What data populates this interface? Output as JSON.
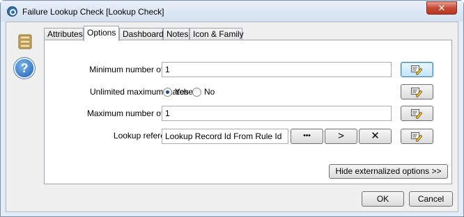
{
  "window": {
    "title": "Failure Lookup Check [Lookup Check]",
    "close_glyph": "✕"
  },
  "sidebar": {
    "icons": [
      "database-icon",
      "help-icon"
    ],
    "help_glyph": "?"
  },
  "tabs": [
    {
      "label": "Attributes",
      "active": false
    },
    {
      "label": "Options",
      "active": true
    },
    {
      "label": "Dashboard",
      "active": false
    },
    {
      "label": "Notes",
      "active": false
    },
    {
      "label": "Icon & Family",
      "active": false
    }
  ],
  "form": {
    "min_matches": {
      "label": "Minimum number of matches",
      "value": "1"
    },
    "unlimited_max": {
      "label": "Unlimited maximum matches",
      "options": [
        {
          "label": "Yes",
          "selected": true
        },
        {
          "label": "No",
          "selected": false
        }
      ]
    },
    "max_matches": {
      "label": "Maximum number of matches",
      "value": "1"
    },
    "lookup_ref": {
      "label": "Lookup reference data",
      "value": "Lookup Record Id From Rule Id",
      "browse_label": "•••",
      "next_label": ">",
      "clear_label": "✕"
    }
  },
  "buttons": {
    "hide_externalized": "Hide externalized options >>",
    "ok": "OK",
    "cancel": "Cancel"
  },
  "colors": {
    "window_frame": "#e4ecf7",
    "client_bg": "#f0f0f0",
    "close_red": "#c44a36",
    "radio_dot": "#1a4d94"
  }
}
